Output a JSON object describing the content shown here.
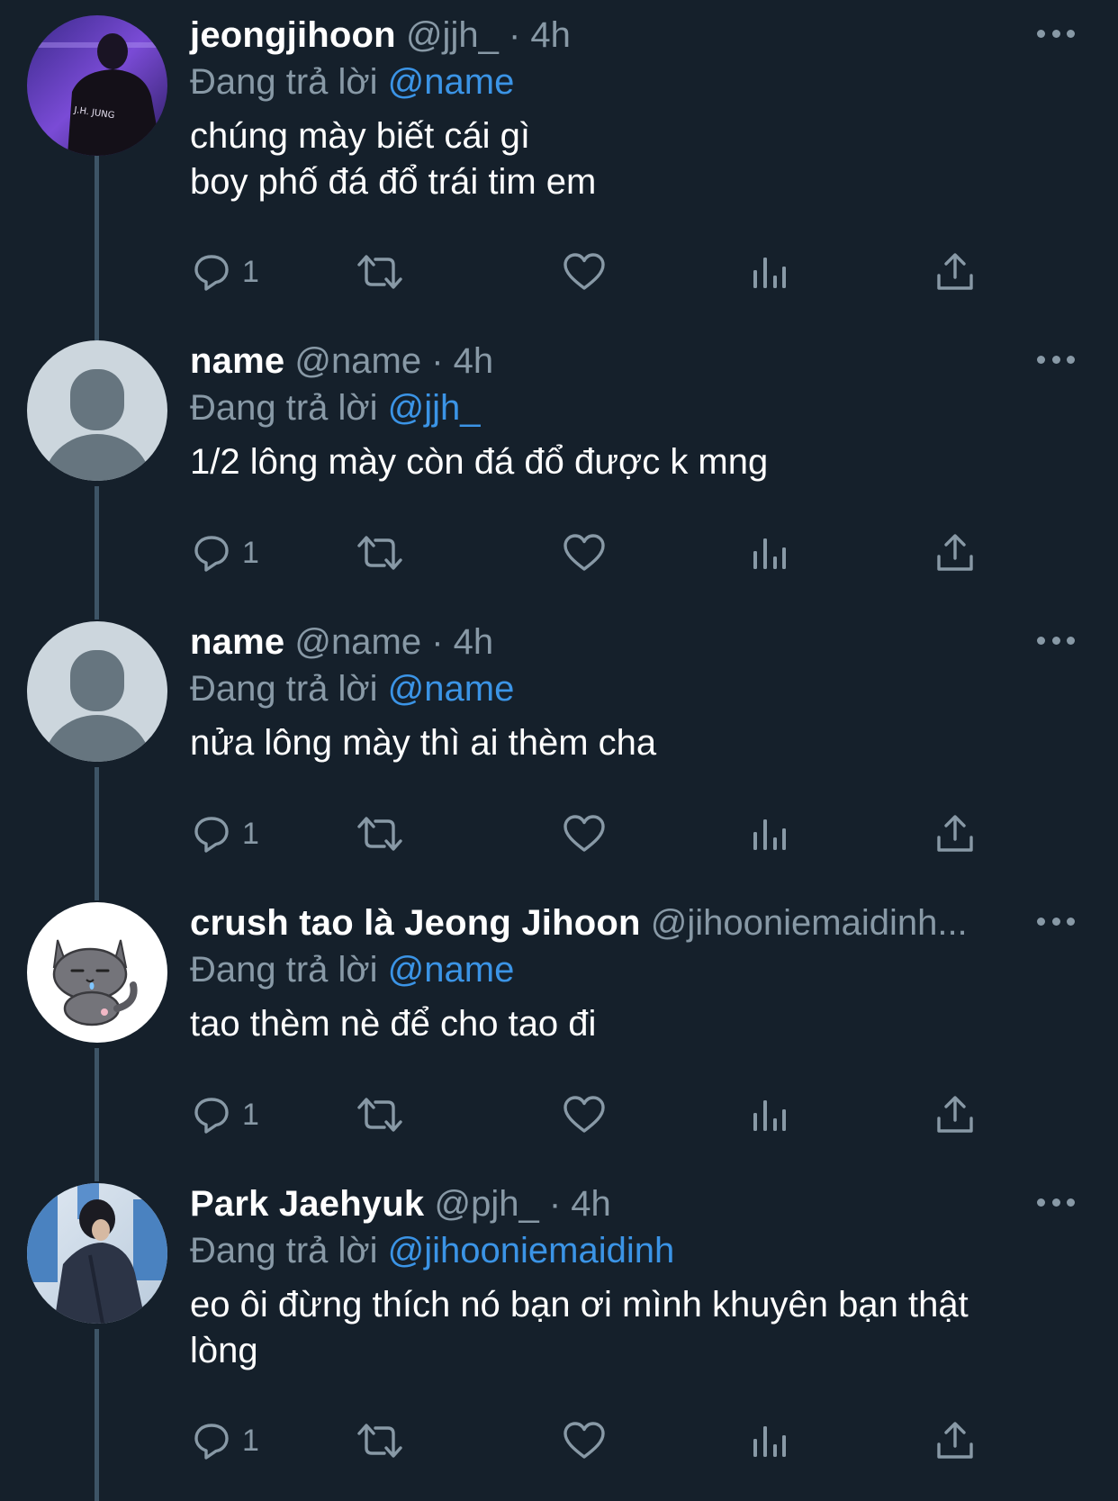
{
  "reply_prefix": "Đang trả lời",
  "tweets": [
    {
      "display_name": "jeongjihoon",
      "handle": "@jjh_",
      "separator": "·",
      "time": "4h",
      "reply_to": "@name",
      "text_lines": [
        "chúng mày biết cái gì",
        "boy phố đá đổ trái tim em"
      ],
      "avatar": "photo-person-jacket",
      "avatar_jacket_text": "J.H. JUNG",
      "reply_count": "1"
    },
    {
      "display_name": "name",
      "handle": "@name",
      "separator": "·",
      "time": "4h",
      "reply_to": "@jjh_",
      "text_lines": [
        "1/2 lông mày còn đá đổ được k mng"
      ],
      "avatar": "default-profile",
      "reply_count": "1"
    },
    {
      "display_name": "name",
      "handle": "@name",
      "separator": "·",
      "time": "4h",
      "reply_to": "@name",
      "text_lines": [
        "nửa lông mày thì ai thèm cha"
      ],
      "avatar": "default-profile",
      "reply_count": "1"
    },
    {
      "display_name": "crush tao là Jeong Jihoon",
      "handle": "@jihooniemaidinh...",
      "separator": "",
      "time": "",
      "reply_to": "@name",
      "text_lines": [
        "tao thèm nè để cho tao đi"
      ],
      "avatar": "gray-cat-sticker",
      "reply_count": "1"
    },
    {
      "display_name": "Park Jaehyuk",
      "handle": "@pjh_",
      "separator": "·",
      "time": "4h",
      "reply_to": "@jihooniemaidinh",
      "text_lines": [
        "eo ôi đừng thích nó bạn ơi mình khuyên bạn thật",
        "lòng"
      ],
      "avatar": "photo-person-bowed",
      "reply_count": "1"
    }
  ],
  "icons": {
    "reply": "reply-icon",
    "retweet": "retweet-icon",
    "like": "heart-icon",
    "views": "analytics-icon",
    "share": "share-icon",
    "more": "more-icon"
  },
  "colors": {
    "background": "#15202b",
    "secondary_text": "#8899a6",
    "mention": "#3b94e6",
    "thread_line": "#3d5466"
  }
}
